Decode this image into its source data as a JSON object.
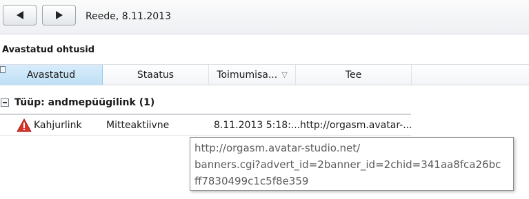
{
  "toolbar": {
    "date": "Reede, 8.11.2013"
  },
  "section": {
    "title": "Avastatud ohtusid"
  },
  "columns": [
    {
      "label": "Avastatud"
    },
    {
      "label": "Staatus"
    },
    {
      "label": "Toimumisa..."
    },
    {
      "label": "Tee"
    }
  ],
  "group": {
    "label": "Tüüp: andmepüügilink (1)"
  },
  "rows": [
    {
      "detected": "Kahjurlink",
      "status": "Mitteaktiivne",
      "time": "8.11.2013 5:18:...",
      "path": "http://orgasm.avatar-..."
    }
  ],
  "tooltip": {
    "lines": [
      "http://orgasm.avatar-studio.net/",
      "banners.cgi?advert_id=2banner_id=2chid=341aa8fca26bc",
      "ff7830499c1c5f8e359"
    ]
  },
  "colors": {
    "active_column": "#c9e6f9",
    "warning": "#d9332a",
    "tooltip_text": "#5c5c5c"
  }
}
